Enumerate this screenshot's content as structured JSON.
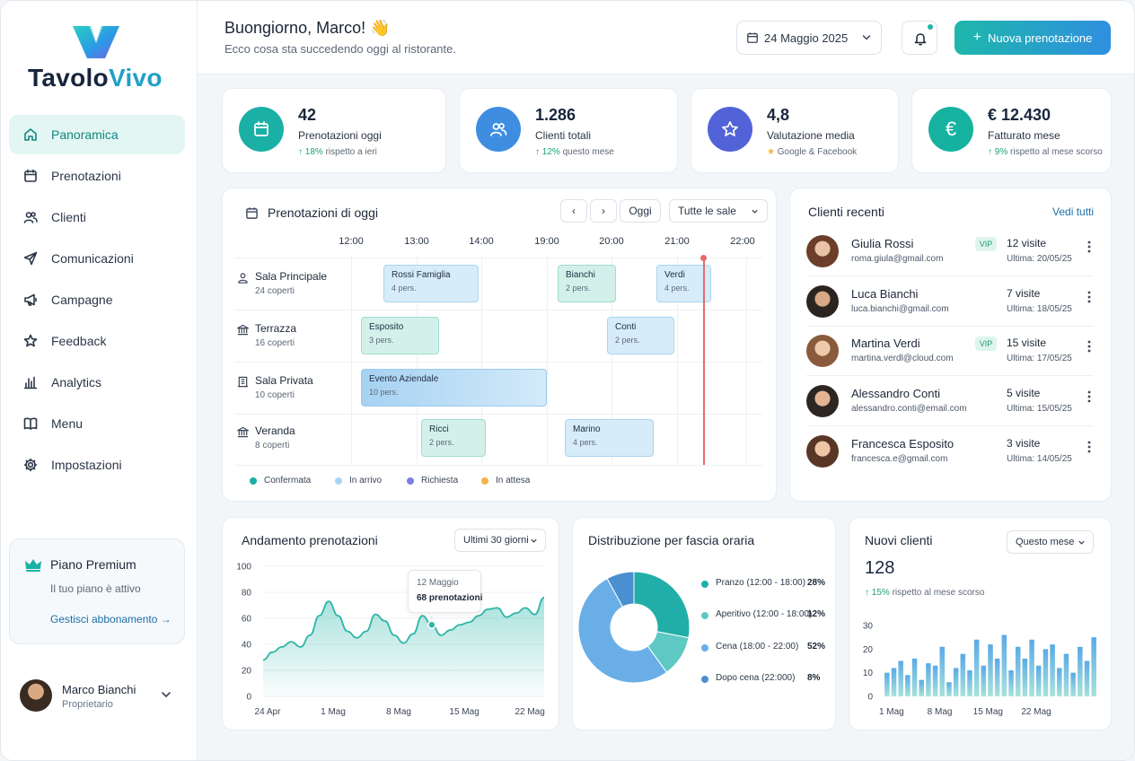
{
  "app": {
    "logo_part1": "Tavolo",
    "logo_part2": "Vivo"
  },
  "sidebar": {
    "items": [
      {
        "label": "Panoramica",
        "icon": "home-icon",
        "active": true
      },
      {
        "label": "Prenotazioni",
        "icon": "calendar-icon"
      },
      {
        "label": "Clienti",
        "icon": "users-icon"
      },
      {
        "label": "Comunicazioni",
        "icon": "send-icon"
      },
      {
        "label": "Campagne",
        "icon": "megaphone-icon"
      },
      {
        "label": "Feedback",
        "icon": "star-icon"
      },
      {
        "label": "Analytics",
        "icon": "bar-chart-icon"
      },
      {
        "label": "Menu",
        "icon": "book-icon"
      },
      {
        "label": "Impostazioni",
        "icon": "gear-icon"
      }
    ],
    "premium": {
      "title": "Piano Premium",
      "subtitle": "Il tuo piano è attivo",
      "link": "Gestisci abbonamento →"
    },
    "user": {
      "name": "Marco Bianchi",
      "role": "Proprietario"
    }
  },
  "header": {
    "greeting": "Buongiorno, Marco! 👋",
    "subtitle": "Ecco cosa sta succedendo oggi al ristorante.",
    "date": "24 Maggio 2025",
    "new_button": "Nuova prenotazione"
  },
  "kpis": [
    {
      "value": "42",
      "label": "Prenotazioni oggi",
      "trend_value": "18%",
      "trend_text": "rispetto a ieri",
      "color": "#1bb0a5",
      "icon": "calendar-icon"
    },
    {
      "value": "1.286",
      "label": "Clienti totali",
      "trend_value": "12%",
      "trend_text": "questo mese",
      "color": "#3f8de0",
      "icon": "users-icon"
    },
    {
      "value": "4,8",
      "label": "Valutazione media",
      "trend_value": "★",
      "trend_text": "Google & Facebook",
      "color": "#5263d8",
      "icon": "star-icon"
    },
    {
      "value": "€ 12.430",
      "label": "Fatturato mese",
      "trend_value": "9%",
      "trend_text": "rispetto al mese scorso",
      "color": "#16b2a0",
      "icon": "euro-icon"
    }
  ],
  "reservations": {
    "title": "Prenotazioni di oggi",
    "today_button": "Oggi",
    "room_filter": "Tutte le sale",
    "hours": [
      "12:00",
      "13:00",
      "14:00",
      "19:00",
      "20:00",
      "21:00",
      "22:00"
    ],
    "rooms": [
      {
        "name": "Sala Principale",
        "seats": "24 coperti"
      },
      {
        "name": "Terrazza",
        "seats": "16 coperti"
      },
      {
        "name": "Sala Privata",
        "seats": "10 coperti"
      },
      {
        "name": "Veranda",
        "seats": "8 coperti"
      }
    ],
    "bookings": [
      {
        "name": "Rossi Famiglia",
        "people": "4 pers."
      },
      {
        "name": "Bianchi",
        "people": "2 pers."
      },
      {
        "name": "Verdi",
        "people": "4 pers."
      },
      {
        "name": "Esposito",
        "people": "3 pers."
      },
      {
        "name": "Conti",
        "people": "2 pers."
      },
      {
        "name": "Evento Aziendale",
        "people": "10 pers."
      },
      {
        "name": "Ricci",
        "people": "2 pers."
      },
      {
        "name": "Marino",
        "people": "4 pers."
      }
    ],
    "legend": [
      {
        "label": "Confermata",
        "color": "#1bb0a5"
      },
      {
        "label": "In arrivo",
        "color": "#a9d5f5"
      },
      {
        "label": "Richiesta",
        "color": "#7b7fe0"
      },
      {
        "label": "In attesa",
        "color": "#f4b44a"
      }
    ]
  },
  "recent_clients": {
    "title": "Clienti recenti",
    "see_all": "Vedi tutti",
    "clients": [
      {
        "name": "Giulia Rossi",
        "email": "roma.giula@gmail.com",
        "vip": "VIP",
        "visits": "12 visite",
        "last": "Ultima: 20/05/25"
      },
      {
        "name": "Luca Bianchi",
        "email": "luca.bianchi@gmail.com",
        "vip": "",
        "visits": "7 visite",
        "last": "Ultima: 18/05/25"
      },
      {
        "name": "Martina Verdi",
        "email": "martina.verdl@cloud.com",
        "vip": "VIP",
        "visits": "15 visite",
        "last": "Ultima: 17/05/25"
      },
      {
        "name": "Alessandro Conti",
        "email": "alessandro.conti@email.com",
        "vip": "",
        "visits": "5 visite",
        "last": "Ultima: 15/05/25"
      },
      {
        "name": "Francesca Esposito",
        "email": "francesca.e@gmail.com",
        "vip": "",
        "visits": "3 visite",
        "last": "Ultima: 14/05/25"
      }
    ]
  },
  "bookings_trend": {
    "title": "Andamento prenotazioni",
    "range": "Ultimi 30 giorni",
    "tooltip_date": "12 Maggio",
    "tooltip_value": "68 prenotazioni"
  },
  "time_distribution": {
    "title": "Distribuzione per fascia oraria"
  },
  "new_clients": {
    "title": "Nuovi clienti",
    "range": "Questo mese",
    "value": "128",
    "trend_value": "15%",
    "trend_text": "rispetto al mese scorso"
  },
  "chart_data": [
    {
      "type": "area",
      "title": "Andamento prenotazioni",
      "x_ticks": [
        "24 Apr",
        "1 Mag",
        "8 Mag",
        "15 Mag",
        "22 Mag"
      ],
      "y_ticks": [
        0,
        20,
        40,
        60,
        80,
        100
      ],
      "ylim": [
        0,
        100
      ],
      "x": [
        0,
        1,
        2,
        3,
        4,
        5,
        6,
        7,
        8,
        9,
        10,
        11,
        12,
        13,
        14,
        15,
        16,
        17,
        18,
        19,
        20,
        21,
        22,
        23,
        24,
        25,
        26,
        27,
        28,
        29,
        30
      ],
      "values": [
        28,
        34,
        38,
        42,
        38,
        47,
        62,
        73,
        62,
        50,
        45,
        50,
        63,
        58,
        47,
        41,
        48,
        62,
        55,
        47,
        51,
        55,
        57,
        62,
        67,
        68,
        61,
        64,
        68,
        63,
        76
      ],
      "highlight": {
        "date": "12 Maggio",
        "value": 68
      },
      "grid": true,
      "color": "#2fb5a8"
    },
    {
      "type": "pie",
      "title": "Distribuzione per fascia oraria",
      "labels": [
        "Pranzo (12:00 - 18:00)",
        "Aperitivo (12:00 - 18:00)",
        "Cena (18:00 - 22:00)",
        "Dopo cena (22:000)"
      ],
      "values": [
        28,
        12,
        52,
        8
      ],
      "value_labels": [
        "28%",
        "12%",
        "52%",
        "8%"
      ],
      "colors": [
        "#22aea8",
        "#5dc9c2",
        "#6aaee8",
        "#4a8fcf"
      ],
      "donut": true
    },
    {
      "type": "bar",
      "title": "Nuovi clienti",
      "x_ticks": [
        "1 Mag",
        "8 Mag",
        "15 Mag",
        "22 Mag"
      ],
      "y_ticks": [
        0,
        10,
        20,
        30
      ],
      "ylim": [
        0,
        30
      ],
      "values": [
        10,
        12,
        15,
        9,
        16,
        7,
        14,
        13,
        21,
        6,
        12,
        18,
        11,
        24,
        13,
        22,
        16,
        26,
        11,
        21,
        16,
        24,
        13,
        20,
        22,
        12,
        18,
        10,
        21,
        15,
        25
      ],
      "color": "#7ec3ee"
    }
  ]
}
